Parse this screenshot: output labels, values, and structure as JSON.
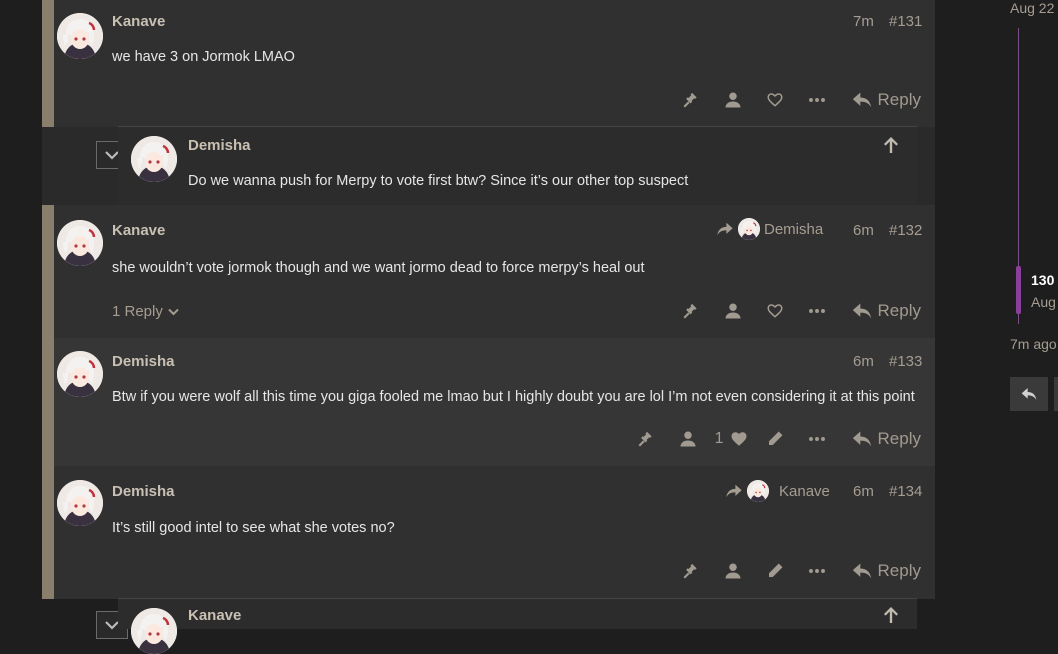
{
  "posts": [
    {
      "username": "Kanave",
      "time": "7m",
      "number": "#131",
      "content": "we have 3 on Jormok LMAO",
      "reply_label": "Reply"
    },
    {
      "username": "Demisha",
      "content": "Do we wanna push for Merpy to vote first btw? Since it’s our other top suspect"
    },
    {
      "username": "Kanave",
      "reply_to": "Demisha",
      "time": "6m",
      "number": "#132",
      "content": "she wouldn’t vote jormok though and we want jormo dead to force merpy’s heal out",
      "replies_label": "1 Reply",
      "reply_label": "Reply"
    },
    {
      "username": "Demisha",
      "time": "6m",
      "number": "#133",
      "content": "Btw if you were wolf all this time you giga fooled me lmao but I highly doubt you are lol I’m not even considering it at this point",
      "like_count": "1",
      "reply_label": "Reply"
    },
    {
      "username": "Demisha",
      "reply_to": "Kanave",
      "time": "6m",
      "number": "#134",
      "content": "It’s still good intel to see what she votes no?",
      "reply_label": "Reply"
    },
    {
      "username": "Kanave"
    }
  ],
  "timeline": {
    "top_date": "Aug 22",
    "current": "130",
    "current_date": "Aug",
    "bottom_age": "7m ago"
  },
  "icons": [
    "gavel-icon",
    "user-icon",
    "heart-icon",
    "ellipsis-icon",
    "reply-icon",
    "pencil-icon",
    "share-arrow-icon",
    "arrow-up-icon",
    "chevron-down-icon"
  ],
  "colors": {
    "accent": "#8a3f9a",
    "rail": "#8a7e6d",
    "background": "#1e1e1e"
  }
}
